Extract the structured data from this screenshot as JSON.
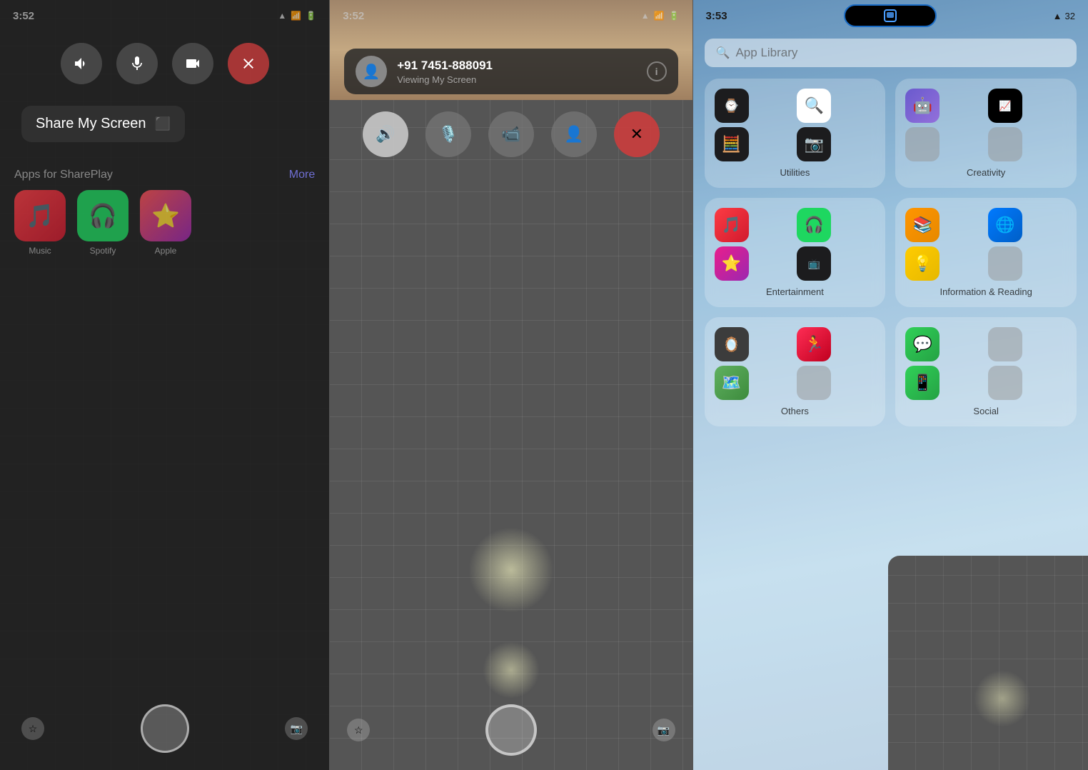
{
  "panel1": {
    "status_time": "3:52",
    "share_screen_label": "Share My Screen",
    "shareplay_title": "Apps for SharePlay",
    "shareplay_more": "More",
    "apps": [
      {
        "name": "Music",
        "emoji": "🎵"
      },
      {
        "name": "Spotify",
        "emoji": "🎧"
      },
      {
        "name": "Apple",
        "emoji": "⭐"
      }
    ]
  },
  "panel2": {
    "status_time": "3:52",
    "caller_number": "+91 7451-888091",
    "caller_status": "Viewing My Screen",
    "controls": [
      "speaker",
      "mic",
      "video",
      "screen-share",
      "close"
    ]
  },
  "panel3": {
    "status_time": "3:53",
    "search_placeholder": "App Library",
    "folders": [
      {
        "label": "Utilities"
      },
      {
        "label": "Creativity"
      },
      {
        "label": "Entertainment"
      },
      {
        "label": "Information & Reading"
      },
      {
        "label": "Others"
      },
      {
        "label": "Social"
      }
    ]
  }
}
